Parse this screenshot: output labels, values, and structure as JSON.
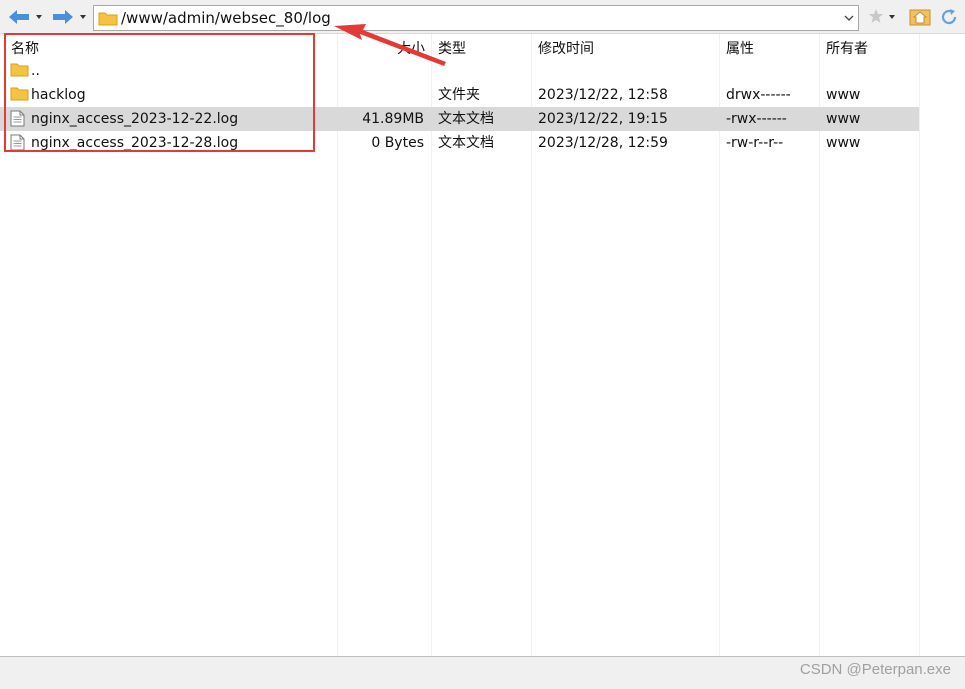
{
  "address_bar": {
    "path": "/www/admin/websec_80/log"
  },
  "toolbar": {
    "back_icon": "arrow-left-icon",
    "forward_icon": "arrow-right-icon",
    "bookmark_icon": "star-icon",
    "home_icon": "home-icon",
    "refresh_icon": "refresh-icon"
  },
  "columns": {
    "name": "名称",
    "size": "大小",
    "type": "类型",
    "modified": "修改时间",
    "attributes": "属性",
    "owner": "所有者"
  },
  "files": [
    {
      "icon": "folder-icon",
      "name": "..",
      "size": "",
      "type": "",
      "modified": "",
      "attributes": "",
      "owner": ""
    },
    {
      "icon": "folder-icon",
      "name": "hacklog",
      "size": "",
      "type": "文件夹",
      "modified": "2023/12/22, 12:58",
      "attributes": "drwx------",
      "owner": "www"
    },
    {
      "icon": "file-icon",
      "name": "nginx_access_2023-12-22.log",
      "size": "41.89MB",
      "type": "文本文档",
      "modified": "2023/12/22, 19:15",
      "attributes": "-rwx------",
      "owner": "www",
      "selected": true
    },
    {
      "icon": "file-icon",
      "name": "nginx_access_2023-12-28.log",
      "size": "0 Bytes",
      "type": "文本文档",
      "modified": "2023/12/28, 12:59",
      "attributes": "-rw-r--r--",
      "owner": "www"
    }
  ],
  "watermark": "CSDN @Peterpan.exe",
  "colors": {
    "annotation": "#e53935",
    "selected_row": "#d9d9d9",
    "folder": "#f5c342",
    "nav_arrow": "#4a8fd8"
  }
}
